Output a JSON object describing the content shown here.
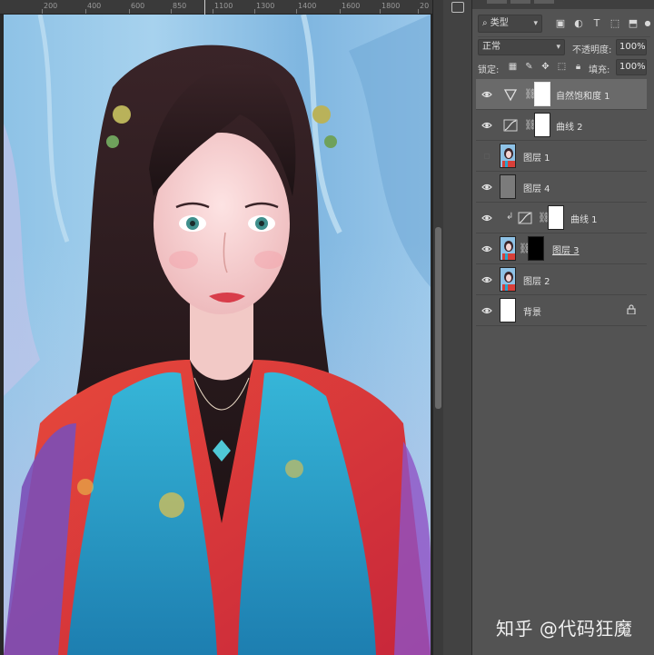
{
  "ruler": {
    "ticks": [
      "200",
      "400",
      "600",
      "850",
      "1100",
      "1300",
      "1400",
      "1600",
      "1800",
      "20"
    ]
  },
  "panel": {
    "filter_type": "类型",
    "blend_mode": "正常",
    "opacity_label": "不透明度:",
    "opacity_value": "100%",
    "lock_label": "锁定:",
    "fill_label": "填充:",
    "fill_value": "100%"
  },
  "layers": [
    {
      "name": "自然饱和度 1",
      "kind": "adjustment-vibrance",
      "visible": true,
      "selected": true
    },
    {
      "name": "曲线 2",
      "kind": "adjustment-curves",
      "visible": true
    },
    {
      "name": "图层 1",
      "kind": "image",
      "visible": false
    },
    {
      "name": "图层 4",
      "kind": "fill-gray",
      "visible": true
    },
    {
      "name": "曲线 1",
      "kind": "adjustment-curves-clipped",
      "visible": true
    },
    {
      "name": "图层 3",
      "kind": "image-with-mask",
      "visible": true
    },
    {
      "name": "图层 2",
      "kind": "image",
      "visible": true
    },
    {
      "name": "背景",
      "kind": "background-locked",
      "visible": true
    }
  ],
  "watermark": "知乎 @代码狂魔",
  "colors": {
    "panel_bg": "#535353",
    "selected_row": "#6a6a6a",
    "canvas_bg": "#282828"
  }
}
